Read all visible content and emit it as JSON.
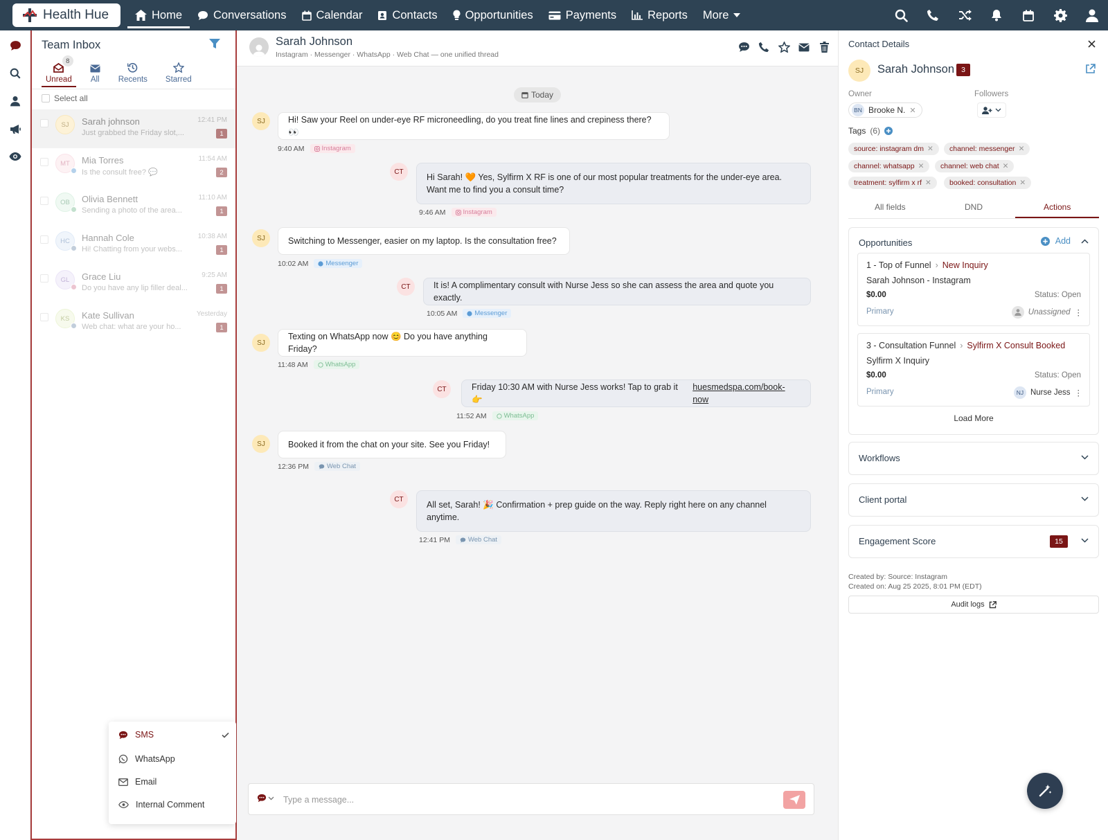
{
  "brand": {
    "name": "Health Hue"
  },
  "nav": {
    "home": "Home",
    "conversations": "Conversations",
    "calendar": "Calendar",
    "contacts": "Contacts",
    "opportunities": "Opportunities",
    "payments": "Payments",
    "reports": "Reports",
    "more": "More"
  },
  "inbox": {
    "title": "Team Inbox",
    "unread_count": "8",
    "tabs": {
      "unread": "Unread",
      "all": "All",
      "recents": "Recents",
      "starred": "Starred"
    },
    "select_all": "Select all",
    "conversations": [
      {
        "initials": "SJ",
        "name": "Sarah johnson",
        "preview": "Just grabbed the Friday slot,...",
        "time": "12:41 PM",
        "count": "1"
      },
      {
        "initials": "MT",
        "name": "Mia Torres",
        "preview": "Is the consult free? 💬",
        "time": "11:54 AM",
        "count": "2"
      },
      {
        "initials": "OB",
        "name": "Olivia Bennett",
        "preview": "Sending a photo of the area...",
        "time": "11:10 AM",
        "count": "1"
      },
      {
        "initials": "HC",
        "name": "Hannah Cole",
        "preview": "Hi! Chatting from your webs...",
        "time": "10:38 AM",
        "count": "1"
      },
      {
        "initials": "GL",
        "name": "Grace Liu",
        "preview": "Do you have any lip filler deal...",
        "time": "9:25 AM",
        "count": "1"
      },
      {
        "initials": "KS",
        "name": "Kate Sullivan",
        "preview": "Web chat: what are your ho...",
        "time": "Yesterday",
        "count": "1"
      }
    ]
  },
  "channel_menu": {
    "sms": "SMS",
    "whatsapp": "WhatsApp",
    "email": "Email",
    "internal": "Internal Comment"
  },
  "chat": {
    "name": "Sarah Johnson",
    "subtitle": "Instagram · Messenger · WhatsApp · Web Chat — one unified thread",
    "today": "Today",
    "messages": [
      {
        "dir": "in",
        "initials": "SJ",
        "text": "Hi! Saw your Reel on under-eye RF microneedling, do you treat fine lines and crepiness there? 👀",
        "time": "9:40 AM",
        "channel": "Instagram"
      },
      {
        "dir": "out",
        "initials": "CT",
        "text": "Hi Sarah! 🧡 Yes, Sylfirm X RF is one of our most popular treatments for the under-eye area. Want me to find you a consult time?",
        "time": "9:46 AM",
        "channel": "Instagram"
      },
      {
        "dir": "in",
        "initials": "SJ",
        "text": "Switching to Messenger, easier on my laptop. Is the consultation free?",
        "time": "10:02 AM",
        "channel": "Messenger"
      },
      {
        "dir": "out",
        "initials": "CT",
        "text": "It is! A complimentary consult with Nurse Jess so she can assess the area and quote you exactly.",
        "time": "10:05 AM",
        "channel": "Messenger"
      },
      {
        "dir": "in",
        "initials": "SJ",
        "text": "Texting on WhatsApp now 😊 Do you have anything Friday?",
        "time": "11:48 AM",
        "channel": "WhatsApp"
      },
      {
        "dir": "out",
        "initials": "CT",
        "text": "Friday 10:30 AM with Nurse Jess works! Tap to grab it 👉",
        "link": "huesmedspa.com/book-now",
        "time": "11:52 AM",
        "channel": "WhatsApp"
      },
      {
        "dir": "in",
        "initials": "SJ",
        "text": "Booked it from the chat on your site. See you Friday!",
        "time": "12:36 PM",
        "channel": "Web Chat"
      },
      {
        "dir": "out",
        "initials": "CT",
        "text": "All set, Sarah! 🎉 Confirmation + prep guide on the way. Reply right here on any channel anytime.",
        "time": "12:41 PM",
        "channel": "Web Chat"
      }
    ],
    "composer_placeholder": "Type a message..."
  },
  "details": {
    "title": "Contact Details",
    "initials": "SJ",
    "name": "Sarah Johnson",
    "badge": "3",
    "owner_label": "Owner",
    "followers_label": "Followers",
    "owner": {
      "initials": "BN",
      "name": "Brooke N."
    },
    "tags_label": "Tags",
    "tags_count": "(6)",
    "tags": [
      "source: instagram dm",
      "channel: messenger",
      "channel: whatsapp",
      "channel: web chat",
      "treatment: sylfirm x rf",
      "booked: consultation"
    ],
    "tabs": {
      "all": "All fields",
      "dnd": "DND",
      "actions": "Actions"
    },
    "opportunities": {
      "title": "Opportunities",
      "add": "Add",
      "items": [
        {
          "pipeline": "1 - Top of Funnel",
          "stage": "New Inquiry",
          "name": "Sarah Johnson - Instagram",
          "amount": "$0.00",
          "status": "Status: Open",
          "primary": "Primary",
          "assignee": "Unassigned"
        },
        {
          "pipeline": "3 - Consultation Funnel",
          "stage": "Sylfirm X Consult Booked",
          "name": "Sylfirm X Inquiry",
          "amount": "$0.00",
          "status": "Status: Open",
          "primary": "Primary",
          "assignee_initials": "NJ",
          "assignee": "Nurse Jess"
        }
      ],
      "load_more": "Load More"
    },
    "workflows": "Workflows",
    "client_portal": "Client portal",
    "engagement": "Engagement Score",
    "engagement_score": "15",
    "created_by": "Created by: Source: Instagram",
    "created_on": "Created on: Aug 25 2025, 8:01 PM (EDT)",
    "audit": "Audit logs"
  },
  "colors": {
    "topbar": "#2e4354",
    "accent": "#7a1515",
    "instagram": "#d77f9b",
    "messenger": "#5b9bd5",
    "whatsapp": "#7cbd93"
  }
}
